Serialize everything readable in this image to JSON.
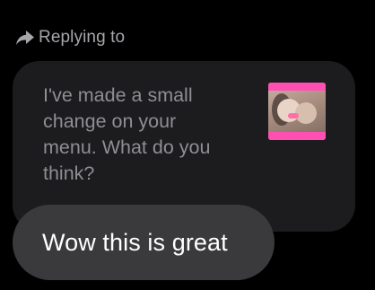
{
  "reply_header": {
    "icon": "reply-arrow-icon",
    "label": "Replying to"
  },
  "quoted_message": {
    "text": "I've made a small\nchange on your\nmenu. What do you\nthink?",
    "thumbnail": {
      "icon": "photo-thumbnail",
      "frame_color": "#ff4fb3"
    }
  },
  "reply_message": {
    "text": "Wow this is great"
  },
  "colors": {
    "background": "#000000",
    "quoted_bubble": "#1c1c1f",
    "reply_bubble": "#3a3a3c",
    "header_text": "#a6a6ab",
    "quoted_text": "#8e8e93",
    "reply_text": "#ffffff"
  }
}
